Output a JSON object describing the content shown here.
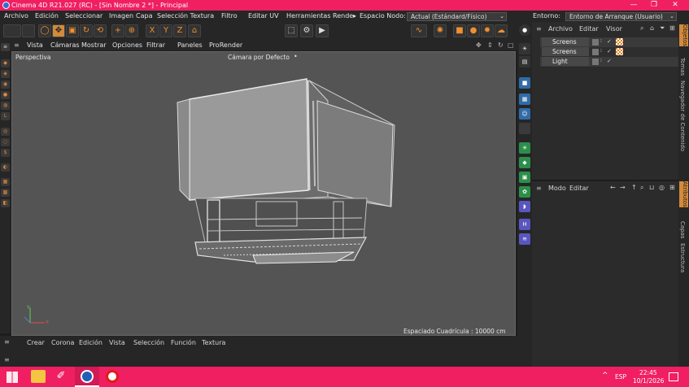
{
  "window": {
    "title": "Cinema 4D R21.027 (RC) - [Sin Nombre 2 *] - Principal",
    "minimize": "—",
    "restore": "❐",
    "close": "✕"
  },
  "menu": {
    "items": [
      "Archivo",
      "Edición",
      "Seleccionar",
      "Imagen",
      "Capa",
      "Selección Textura",
      "Filtro",
      "Editar UV",
      "Herramientas",
      "Rende"
    ],
    "more": "▸",
    "workspace_label": "Espacio Nodo:",
    "workspace_value": "Actual (Estándard/Físico)",
    "env_label": "Entorno:",
    "env_value": "Entorno de Arranque (Usuario)"
  },
  "toolbar": {
    "axis_x": "X",
    "axis_y": "Y",
    "axis_z": "Z"
  },
  "viewport": {
    "menu": [
      "Vista",
      "Cámaras",
      "Mostrar",
      "Opciones",
      "Filtrar",
      "Paneles",
      "ProRender"
    ],
    "name": "Perspectiva",
    "camera": "Cámara por Defecto",
    "camera_mark": "•",
    "grid": "Espaciado Cuadrícula : 10000 cm",
    "axis_y": "Y",
    "axis_x": "X"
  },
  "bottom_menu": [
    "Crear",
    "Corona",
    "Edición",
    "Vista",
    "Selección",
    "Función",
    "Textura"
  ],
  "objects": {
    "menu": [
      "Archivo",
      "Editar",
      "Visor"
    ],
    "rows": [
      {
        "name": "Screens"
      },
      {
        "name": "Screens"
      },
      {
        "name": "Light"
      }
    ]
  },
  "attributes": {
    "menu": [
      "Modo",
      "Editar"
    ]
  },
  "right_tabs_top": [
    "Objetos",
    "Tomas",
    "Navegador de Contenido"
  ],
  "right_tabs_bottom": [
    "Atributos",
    "Capas",
    "Estructura"
  ],
  "taskbar": {
    "lang": "ESP",
    "time": "22:45",
    "date": "10/1/2026",
    "tray_arrow": "^"
  },
  "colors": {
    "titlebar": "#ef1f62",
    "accent": "#d28a3b",
    "panel": "#262626",
    "viewport": "#545454"
  }
}
